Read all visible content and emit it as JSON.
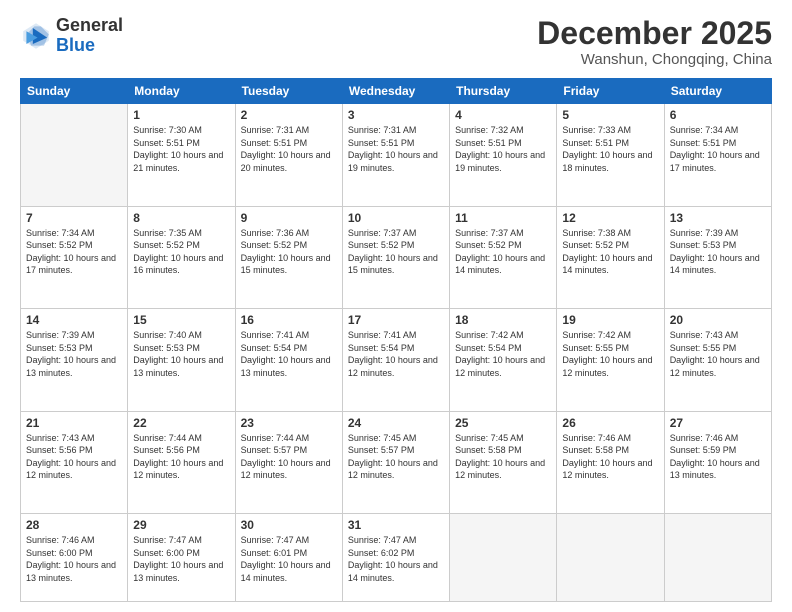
{
  "header": {
    "logo_general": "General",
    "logo_blue": "Blue",
    "month_year": "December 2025",
    "location": "Wanshun, Chongqing, China"
  },
  "weekdays": [
    "Sunday",
    "Monday",
    "Tuesday",
    "Wednesday",
    "Thursday",
    "Friday",
    "Saturday"
  ],
  "weeks": [
    [
      {
        "day": "",
        "info": ""
      },
      {
        "day": "1",
        "info": "Sunrise: 7:30 AM\nSunset: 5:51 PM\nDaylight: 10 hours\nand 21 minutes."
      },
      {
        "day": "2",
        "info": "Sunrise: 7:31 AM\nSunset: 5:51 PM\nDaylight: 10 hours\nand 20 minutes."
      },
      {
        "day": "3",
        "info": "Sunrise: 7:31 AM\nSunset: 5:51 PM\nDaylight: 10 hours\nand 19 minutes."
      },
      {
        "day": "4",
        "info": "Sunrise: 7:32 AM\nSunset: 5:51 PM\nDaylight: 10 hours\nand 19 minutes."
      },
      {
        "day": "5",
        "info": "Sunrise: 7:33 AM\nSunset: 5:51 PM\nDaylight: 10 hours\nand 18 minutes."
      },
      {
        "day": "6",
        "info": "Sunrise: 7:34 AM\nSunset: 5:51 PM\nDaylight: 10 hours\nand 17 minutes."
      }
    ],
    [
      {
        "day": "7",
        "info": "Sunrise: 7:34 AM\nSunset: 5:52 PM\nDaylight: 10 hours\nand 17 minutes."
      },
      {
        "day": "8",
        "info": "Sunrise: 7:35 AM\nSunset: 5:52 PM\nDaylight: 10 hours\nand 16 minutes."
      },
      {
        "day": "9",
        "info": "Sunrise: 7:36 AM\nSunset: 5:52 PM\nDaylight: 10 hours\nand 15 minutes."
      },
      {
        "day": "10",
        "info": "Sunrise: 7:37 AM\nSunset: 5:52 PM\nDaylight: 10 hours\nand 15 minutes."
      },
      {
        "day": "11",
        "info": "Sunrise: 7:37 AM\nSunset: 5:52 PM\nDaylight: 10 hours\nand 14 minutes."
      },
      {
        "day": "12",
        "info": "Sunrise: 7:38 AM\nSunset: 5:52 PM\nDaylight: 10 hours\nand 14 minutes."
      },
      {
        "day": "13",
        "info": "Sunrise: 7:39 AM\nSunset: 5:53 PM\nDaylight: 10 hours\nand 14 minutes."
      }
    ],
    [
      {
        "day": "14",
        "info": "Sunrise: 7:39 AM\nSunset: 5:53 PM\nDaylight: 10 hours\nand 13 minutes."
      },
      {
        "day": "15",
        "info": "Sunrise: 7:40 AM\nSunset: 5:53 PM\nDaylight: 10 hours\nand 13 minutes."
      },
      {
        "day": "16",
        "info": "Sunrise: 7:41 AM\nSunset: 5:54 PM\nDaylight: 10 hours\nand 13 minutes."
      },
      {
        "day": "17",
        "info": "Sunrise: 7:41 AM\nSunset: 5:54 PM\nDaylight: 10 hours\nand 12 minutes."
      },
      {
        "day": "18",
        "info": "Sunrise: 7:42 AM\nSunset: 5:54 PM\nDaylight: 10 hours\nand 12 minutes."
      },
      {
        "day": "19",
        "info": "Sunrise: 7:42 AM\nSunset: 5:55 PM\nDaylight: 10 hours\nand 12 minutes."
      },
      {
        "day": "20",
        "info": "Sunrise: 7:43 AM\nSunset: 5:55 PM\nDaylight: 10 hours\nand 12 minutes."
      }
    ],
    [
      {
        "day": "21",
        "info": "Sunrise: 7:43 AM\nSunset: 5:56 PM\nDaylight: 10 hours\nand 12 minutes."
      },
      {
        "day": "22",
        "info": "Sunrise: 7:44 AM\nSunset: 5:56 PM\nDaylight: 10 hours\nand 12 minutes."
      },
      {
        "day": "23",
        "info": "Sunrise: 7:44 AM\nSunset: 5:57 PM\nDaylight: 10 hours\nand 12 minutes."
      },
      {
        "day": "24",
        "info": "Sunrise: 7:45 AM\nSunset: 5:57 PM\nDaylight: 10 hours\nand 12 minutes."
      },
      {
        "day": "25",
        "info": "Sunrise: 7:45 AM\nSunset: 5:58 PM\nDaylight: 10 hours\nand 12 minutes."
      },
      {
        "day": "26",
        "info": "Sunrise: 7:46 AM\nSunset: 5:58 PM\nDaylight: 10 hours\nand 12 minutes."
      },
      {
        "day": "27",
        "info": "Sunrise: 7:46 AM\nSunset: 5:59 PM\nDaylight: 10 hours\nand 13 minutes."
      }
    ],
    [
      {
        "day": "28",
        "info": "Sunrise: 7:46 AM\nSunset: 6:00 PM\nDaylight: 10 hours\nand 13 minutes."
      },
      {
        "day": "29",
        "info": "Sunrise: 7:47 AM\nSunset: 6:00 PM\nDaylight: 10 hours\nand 13 minutes."
      },
      {
        "day": "30",
        "info": "Sunrise: 7:47 AM\nSunset: 6:01 PM\nDaylight: 10 hours\nand 14 minutes."
      },
      {
        "day": "31",
        "info": "Sunrise: 7:47 AM\nSunset: 6:02 PM\nDaylight: 10 hours\nand 14 minutes."
      },
      {
        "day": "",
        "info": ""
      },
      {
        "day": "",
        "info": ""
      },
      {
        "day": "",
        "info": ""
      }
    ]
  ]
}
